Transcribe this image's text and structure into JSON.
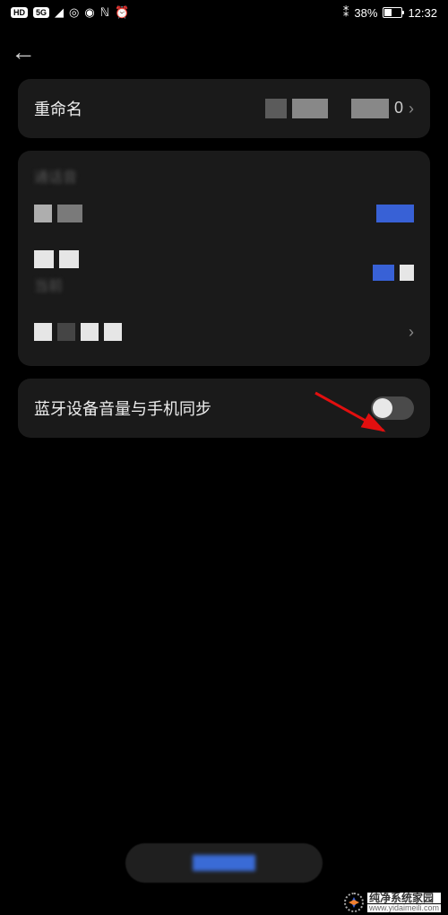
{
  "status": {
    "hd": "HD",
    "fiveg": "5G",
    "battery_pct": "38%",
    "time": "12:32",
    "bt": "⁂"
  },
  "rename_row": {
    "label": "重命名",
    "value_tail": "0"
  },
  "blurred": {
    "subtext": "当前"
  },
  "sync_row": {
    "label": "蓝牙设备音量与手机同步"
  },
  "watermark": {
    "line1": "纯净系统家园",
    "line2": "www.yidaimeili.com"
  }
}
